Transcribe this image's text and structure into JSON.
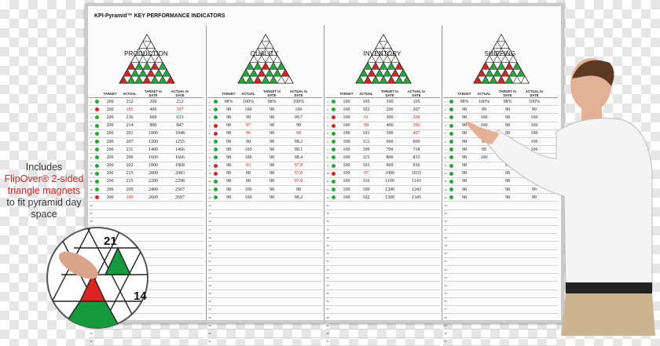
{
  "board": {
    "title": "KPI-Pyramid™ KEY PERFORMANCE INDICATORS",
    "headers": [
      "TARGET",
      "ACTUAL",
      "TARGET to DATE",
      "ACTUAL to DATE"
    ],
    "panels": [
      {
        "label": "PRODUCTION",
        "rows": [
          {
            "d": "g",
            "v": [
              "200",
              "212",
              "200",
              "212"
            ]
          },
          {
            "d": "r",
            "v": [
              "200",
              "185",
              "400",
              "397"
            ],
            "red": [
              1,
              3
            ]
          },
          {
            "d": "g",
            "v": [
              "200",
              "236",
              "600",
              "633"
            ]
          },
          {
            "d": "g",
            "v": [
              "200",
              "214",
              "800",
              "847"
            ]
          },
          {
            "d": "g",
            "v": [
              "200",
              "201",
              "1000",
              "1048"
            ]
          },
          {
            "d": "g",
            "v": [
              "200",
              "207",
              "1200",
              "1255"
            ]
          },
          {
            "d": "g",
            "v": [
              "200",
              "211",
              "1400",
              "1466"
            ]
          },
          {
            "d": "g",
            "v": [
              "200",
              "200",
              "1600",
              "1666"
            ]
          },
          {
            "d": "g",
            "v": [
              "200",
              "202",
              "1800",
              "1868"
            ]
          },
          {
            "d": "g",
            "v": [
              "200",
              "215",
              "2000",
              "2083"
            ]
          },
          {
            "d": "g",
            "v": [
              "200",
              "215",
              "2200",
              "2298"
            ]
          },
          {
            "d": "g",
            "v": [
              "200",
              "209",
              "2400",
              "2507"
            ]
          },
          {
            "d": "r",
            "v": [
              "200",
              "190",
              "2600",
              "2697"
            ],
            "red": [
              1
            ]
          }
        ]
      },
      {
        "label": "QUALITY",
        "rows": [
          {
            "d": "g",
            "v": [
              "98%",
              "100%",
              "98%",
              "100%"
            ]
          },
          {
            "d": "g",
            "v": [
              "98",
              "100",
              "98",
              "100"
            ]
          },
          {
            "d": "g",
            "v": [
              "98",
              "99",
              "98",
              "99.7"
            ]
          },
          {
            "d": "r",
            "v": [
              "98",
              "97",
              "98",
              "99"
            ],
            "red": [
              1
            ]
          },
          {
            "d": "r",
            "v": [
              "98",
              "96",
              "98",
              "98"
            ],
            "red": [
              1,
              3
            ]
          },
          {
            "d": "g",
            "v": [
              "98",
              "99",
              "98",
              "98.2"
            ]
          },
          {
            "d": "g",
            "v": [
              "98",
              "100",
              "98",
              "98.1"
            ]
          },
          {
            "d": "g",
            "v": [
              "98",
              "100",
              "98",
              "98.4"
            ]
          },
          {
            "d": "r",
            "v": [
              "98",
              "93",
              "98",
              "97.8"
            ],
            "red": [
              1,
              3
            ]
          },
          {
            "d": "r",
            "v": [
              "98",
              "98",
              "98",
              "97.8"
            ],
            "red": [
              3
            ]
          },
          {
            "d": "g",
            "v": [
              "98",
              "98",
              "98",
              "97.8"
            ],
            "red": [
              3
            ]
          },
          {
            "d": "g",
            "v": [
              "98",
              "100",
              "98",
              "98"
            ]
          },
          {
            "d": "g",
            "v": [
              "98",
              "100",
              "98",
              "98.2"
            ]
          }
        ]
      },
      {
        "label": "INVENTORY",
        "rows": [
          {
            "d": "g",
            "v": [
              "100",
              "105",
              "100",
              "105"
            ]
          },
          {
            "d": "g",
            "v": [
              "100",
              "102",
              "200",
              "207"
            ]
          },
          {
            "d": "r",
            "v": [
              "100",
              "91",
              "300",
              "298"
            ],
            "red": [
              1,
              3
            ]
          },
          {
            "d": "r",
            "v": [
              "100",
              "98",
              "400",
              "396"
            ],
            "red": [
              1,
              3
            ]
          },
          {
            "d": "g",
            "v": [
              "100",
              "101",
              "500",
              "497"
            ],
            "red": [
              3
            ]
          },
          {
            "d": "g",
            "v": [
              "100",
              "112",
              "600",
              "609"
            ]
          },
          {
            "d": "g",
            "v": [
              "100",
              "109",
              "700",
              "718"
            ]
          },
          {
            "d": "g",
            "v": [
              "100",
              "115",
              "800",
              "833"
            ]
          },
          {
            "d": "g",
            "v": [
              "100",
              "103",
              "900",
              "936"
            ]
          },
          {
            "d": "r",
            "v": [
              "100",
              "97",
              "1000",
              "1033"
            ],
            "red": [
              1
            ]
          },
          {
            "d": "g",
            "v": [
              "100",
              "110",
              "1100",
              "1143"
            ]
          },
          {
            "d": "g",
            "v": [
              "100",
              "100",
              "1200",
              "1243"
            ]
          },
          {
            "d": "g",
            "v": [
              "100",
              "102",
              "1300",
              "1345"
            ]
          }
        ]
      },
      {
        "label": "SHIPPING",
        "rows": [
          {
            "d": "g",
            "v": [
              "98%",
              "100%",
              "98%",
              "100%"
            ]
          },
          {
            "d": "g",
            "v": [
              "98",
              "99",
              "98",
              "99"
            ]
          },
          {
            "d": "g",
            "v": [
              "98",
              "100",
              "98",
              "100"
            ]
          },
          {
            "d": "g",
            "v": [
              "98",
              "100",
              "98",
              "100"
            ]
          },
          {
            "d": "g",
            "v": [
              "98",
              "100",
              "98",
              "100"
            ]
          },
          {
            "d": "g",
            "v": [
              "98",
              "99",
              "98",
              "100"
            ]
          },
          {
            "d": "g",
            "v": [
              "98",
              "99",
              "98",
              "100"
            ]
          },
          {
            "d": "g",
            "v": [
              "98",
              "100",
              "98",
              "99"
            ]
          },
          {
            "d": "g",
            "v": [
              "98",
              "",
              "98",
              "99"
            ]
          },
          {
            "d": "g",
            "v": [
              "98",
              "",
              "98",
              "99"
            ]
          },
          {
            "d": "g",
            "v": [
              "98",
              "",
              "98",
              "99"
            ]
          },
          {
            "d": "g",
            "v": [
              "98",
              "",
              "98",
              "99"
            ]
          },
          {
            "d": "g",
            "v": [
              "98",
              "",
              "98",
              "99"
            ]
          }
        ]
      }
    ]
  },
  "callout": {
    "line1": "Includes",
    "line2_red": "FlipOver® 2-sided triangle magnets",
    "line3": "to fit pyramid day space"
  },
  "magnet": {
    "num_top": "21",
    "num_right": "14"
  },
  "colors": {
    "green": "#23a83a",
    "red": "#d42424",
    "magnet_red": "#e0231f",
    "magnet_green": "#149a3c"
  }
}
